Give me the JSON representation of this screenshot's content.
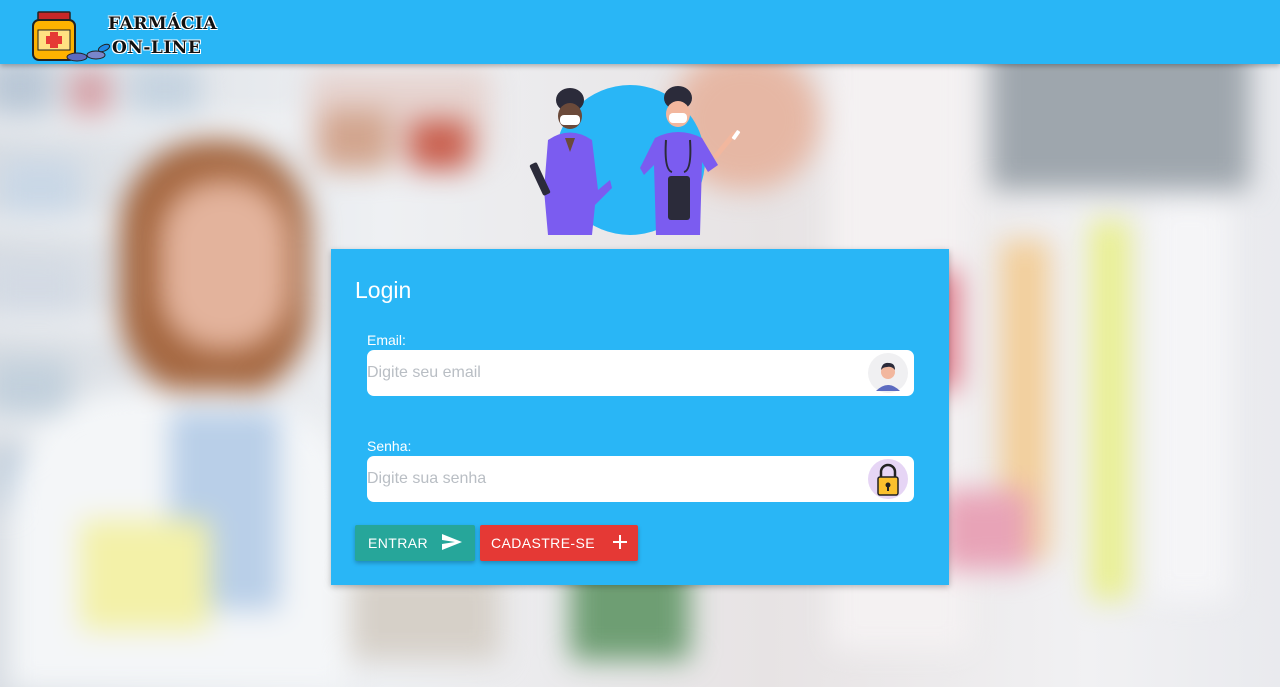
{
  "header": {
    "logo_line1": "FARMÁCIA",
    "logo_line2": "ON-LINE"
  },
  "login": {
    "title": "Login",
    "email": {
      "label": "Email:",
      "placeholder": "Digite seu email",
      "value": "",
      "icon": "user-avatar-icon"
    },
    "password": {
      "label": "Senha:",
      "placeholder": "Digite sua senha",
      "value": "",
      "icon": "padlock-icon"
    },
    "buttons": {
      "enter_label": "ENTRAR",
      "enter_icon": "send-icon",
      "register_label": "CADASTRE-SE",
      "register_icon": "plus-icon"
    }
  },
  "colors": {
    "primary": "#29b6f6",
    "enter_button": "#26a69a",
    "register_button": "#e53935",
    "illustration_accent": "#7b5cf0"
  }
}
